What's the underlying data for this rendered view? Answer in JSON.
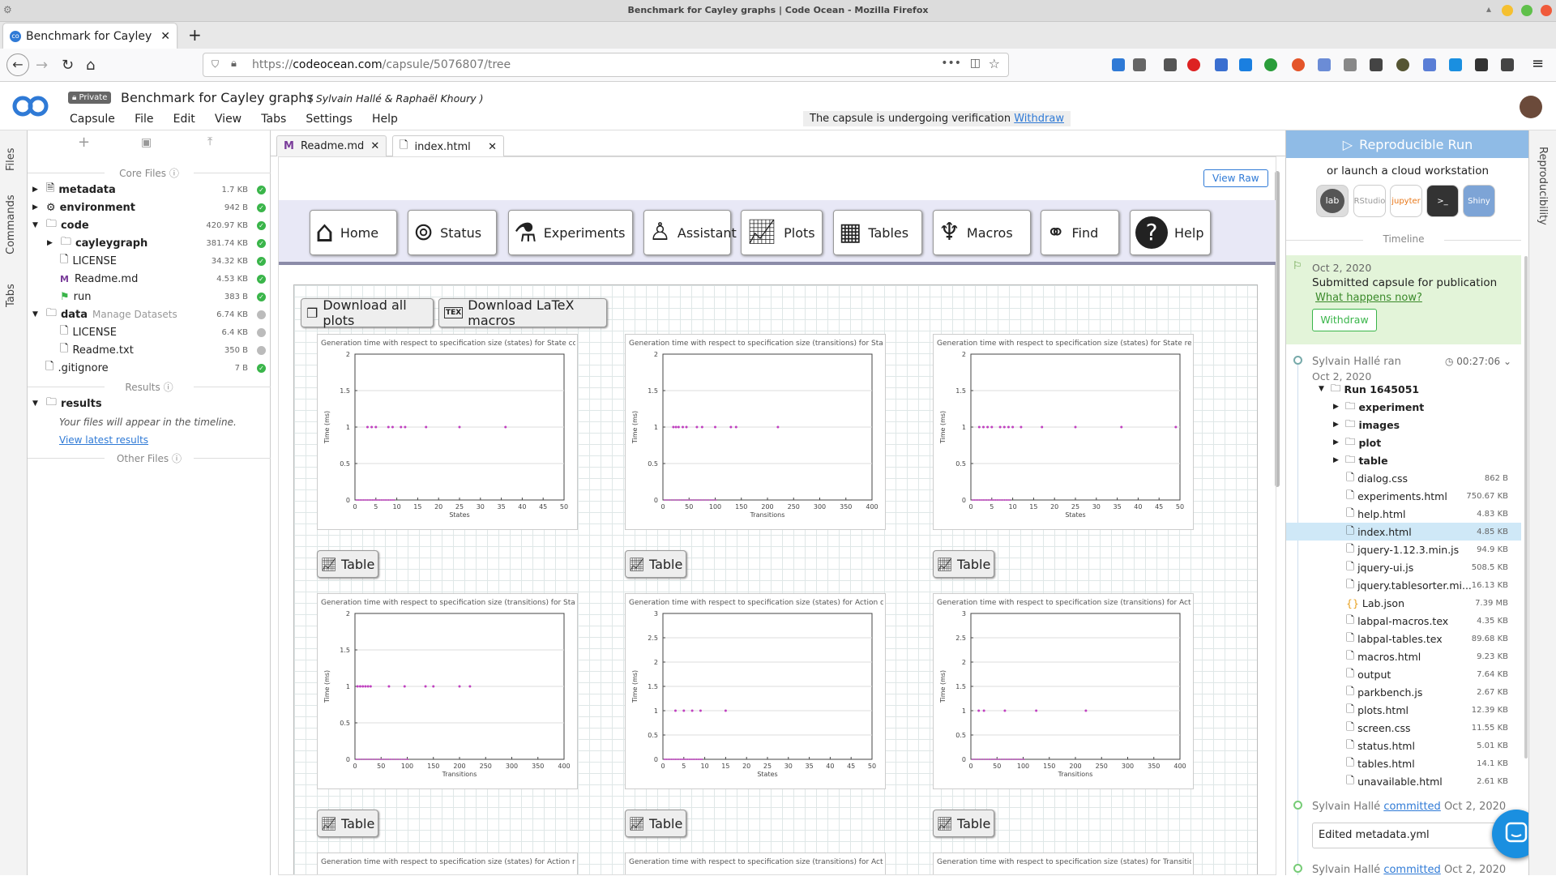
{
  "window": {
    "title": "Benchmark for Cayley graphs | Code Ocean - Mozilla Firefox"
  },
  "browser_tab": {
    "label": "Benchmark for Cayley gr"
  },
  "url": {
    "prefix": "https://",
    "host": "codeocean.com",
    "path": "/capsule/5076807/tree"
  },
  "app": {
    "private_label": "Private",
    "title": "Benchmark for Cayley graphs",
    "authors": "( Sylvain Hallé & Raphaël Khoury )",
    "verification": "The capsule is undergoing verification",
    "withdraw_link": "Withdraw",
    "menu": [
      "Capsule",
      "File",
      "Edit",
      "View",
      "Tabs",
      "Settings",
      "Help"
    ]
  },
  "left_strip": {
    "tabs": [
      "Files",
      "Commands",
      "Tabs"
    ]
  },
  "files": {
    "core_label": "Core Files",
    "results_label": "Results",
    "other_label": "Other Files",
    "rows": [
      {
        "name": "metadata",
        "size": "1.7 KB",
        "bold": true
      },
      {
        "name": "environment",
        "size": "942 B",
        "bold": true
      },
      {
        "name": "code",
        "size": "420.97 KB",
        "bold": true
      },
      {
        "name": "cayleygraph",
        "size": "381.74 KB",
        "bold": true
      },
      {
        "name": "LICENSE",
        "size": "34.32 KB"
      },
      {
        "name": "Readme.md",
        "size": "4.53 KB"
      },
      {
        "name": "run",
        "size": "383 B"
      },
      {
        "name": "data",
        "size": "6.74 KB",
        "bold": true
      },
      {
        "name": "LICENSE",
        "size": "6.4 KB"
      },
      {
        "name": "Readme.txt",
        "size": "350 B"
      },
      {
        "name": ".gitignore",
        "size": "7 B"
      }
    ],
    "manage_datasets": "Manage Datasets",
    "results_folder": "results",
    "results_note": "Your files will appear in the timeline.",
    "view_latest": "View latest results"
  },
  "editor": {
    "tabs": [
      "Readme.md",
      "index.html"
    ],
    "view_raw": "View Raw"
  },
  "page_nav": [
    "Home",
    "Status",
    "Experiments",
    "Assistant",
    "Plots",
    "Tables",
    "Macros",
    "Find",
    "Help"
  ],
  "downloads": {
    "all_plots": "Download all plots",
    "latex": "Download LaTeX macros"
  },
  "plots": [
    {
      "title": "Generation time with respect to specification size (states) for State coverage",
      "xlabel": "States",
      "ylabel": "Time (ms)",
      "xticks": [
        "0",
        "5",
        "10",
        "15",
        "20",
        "25",
        "30",
        "35",
        "40",
        "45",
        "50"
      ],
      "yticks": [
        "0",
        "0.5",
        "1",
        "1.5",
        "2"
      ],
      "ymax": 2,
      "xmax": 50,
      "points": [
        [
          3,
          1
        ],
        [
          4,
          1
        ],
        [
          5,
          1
        ],
        [
          8,
          1
        ],
        [
          9,
          1
        ],
        [
          11,
          1
        ],
        [
          12,
          1
        ],
        [
          17,
          1
        ],
        [
          25,
          1
        ],
        [
          36,
          1
        ]
      ]
    },
    {
      "title": "Generation time with respect to specification size (transitions) for State coverage",
      "xlabel": "Transitions",
      "ylabel": "Time (ms)",
      "xticks": [
        "0",
        "50",
        "100",
        "150",
        "200",
        "250",
        "300",
        "350",
        "400"
      ],
      "yticks": [
        "0",
        "0.5",
        "1",
        "1.5",
        "2"
      ],
      "ymax": 2,
      "xmax": 400,
      "points": [
        [
          20,
          1
        ],
        [
          25,
          1
        ],
        [
          30,
          1
        ],
        [
          38,
          1
        ],
        [
          45,
          1
        ],
        [
          65,
          1
        ],
        [
          75,
          1
        ],
        [
          100,
          1
        ],
        [
          130,
          1
        ],
        [
          140,
          1
        ],
        [
          220,
          1
        ]
      ]
    },
    {
      "title": "Generation time with respect to specification size (states) for State residual coverage",
      "xlabel": "States",
      "ylabel": "Time (ms)",
      "xticks": [
        "0",
        "5",
        "10",
        "15",
        "20",
        "25",
        "30",
        "35",
        "40",
        "45",
        "50"
      ],
      "yticks": [
        "0",
        "0.5",
        "1",
        "1.5",
        "2"
      ],
      "ymax": 2,
      "xmax": 50,
      "points": [
        [
          2,
          1
        ],
        [
          3,
          1
        ],
        [
          4,
          1
        ],
        [
          5,
          1
        ],
        [
          7,
          1
        ],
        [
          8,
          1
        ],
        [
          9,
          1
        ],
        [
          10,
          1
        ],
        [
          12,
          1
        ],
        [
          17,
          1
        ],
        [
          25,
          1
        ],
        [
          36,
          1
        ],
        [
          49,
          1
        ]
      ]
    },
    {
      "title": "Generation time with respect to specification size (transitions) for State residual coverage",
      "xlabel": "Transitions",
      "ylabel": "Time (ms)",
      "xticks": [
        "0",
        "50",
        "100",
        "150",
        "200",
        "250",
        "300",
        "350",
        "400"
      ],
      "yticks": [
        "0",
        "0.5",
        "1",
        "1.5",
        "2"
      ],
      "ymax": 2,
      "xmax": 400,
      "points": [
        [
          5,
          1
        ],
        [
          10,
          1
        ],
        [
          15,
          1
        ],
        [
          20,
          1
        ],
        [
          25,
          1
        ],
        [
          30,
          1
        ],
        [
          65,
          1
        ],
        [
          95,
          1
        ],
        [
          135,
          1
        ],
        [
          150,
          1
        ],
        [
          200,
          1
        ],
        [
          220,
          1
        ]
      ]
    },
    {
      "title": "Generation time with respect to specification size (states) for Action coverage",
      "xlabel": "States",
      "ylabel": "Time (ms)",
      "xticks": [
        "0",
        "5",
        "10",
        "15",
        "20",
        "25",
        "30",
        "35",
        "40",
        "45",
        "50"
      ],
      "yticks": [
        "0",
        "0.5",
        "1",
        "1.5",
        "2",
        "2.5",
        "3"
      ],
      "ymax": 3,
      "xmax": 50,
      "points": [
        [
          3,
          1
        ],
        [
          5,
          1
        ],
        [
          7,
          1
        ],
        [
          9,
          1
        ],
        [
          15,
          1
        ]
      ]
    },
    {
      "title": "Generation time with respect to specification size (transitions) for Action coverage",
      "xlabel": "Transitions",
      "ylabel": "Time (ms)",
      "xticks": [
        "0",
        "50",
        "100",
        "150",
        "200",
        "250",
        "300",
        "350",
        "400"
      ],
      "yticks": [
        "0",
        "0.5",
        "1",
        "1.5",
        "2",
        "2.5",
        "3"
      ],
      "ymax": 3,
      "xmax": 400,
      "points": [
        [
          15,
          1
        ],
        [
          25,
          1
        ],
        [
          65,
          1
        ],
        [
          125,
          1
        ],
        [
          220,
          1
        ]
      ]
    }
  ],
  "bottom_plot_titles": [
    "Generation time with respect to specification size (states) for Action residual coverage",
    "Generation time with respect to specification size (transitions) for Action residual coverage",
    "Generation time with respect to specification size (states) for Transition coverage"
  ],
  "table_label": "Table",
  "right": {
    "run_button": "Reproducible Run",
    "launch_text": "or launch a cloud workstation",
    "workstations": [
      "lab",
      "RStudio",
      "jupyter",
      ">_",
      "Shiny"
    ],
    "timeline_label": "Timeline",
    "submitted": {
      "date": "Oct 2, 2020",
      "text": "Submitted capsule for publication",
      "link": "What happens now?",
      "withdraw": "Withdraw"
    },
    "run": {
      "who": "Sylvain Hallé ran",
      "date": "Oct 2, 2020",
      "duration": "00:27:06",
      "run_name": "Run 1645051"
    },
    "run_items": [
      {
        "name": "experiment",
        "folder": true
      },
      {
        "name": "images",
        "folder": true
      },
      {
        "name": "plot",
        "folder": true
      },
      {
        "name": "table",
        "folder": true
      },
      {
        "name": "dialog.css",
        "size": "862 B"
      },
      {
        "name": "experiments.html",
        "size": "750.67 KB"
      },
      {
        "name": "help.html",
        "size": "4.83 KB"
      },
      {
        "name": "index.html",
        "size": "4.85 KB",
        "selected": true
      },
      {
        "name": "jquery-1.12.3.min.js",
        "size": "94.9 KB"
      },
      {
        "name": "jquery-ui.js",
        "size": "508.5 KB"
      },
      {
        "name": "jquery.tablesorter.mi...",
        "size": "16.13 KB"
      },
      {
        "name": "Lab.json",
        "size": "7.39 MB"
      },
      {
        "name": "labpal-macros.tex",
        "size": "4.35 KB"
      },
      {
        "name": "labpal-tables.tex",
        "size": "89.68 KB"
      },
      {
        "name": "macros.html",
        "size": "9.23 KB"
      },
      {
        "name": "output",
        "size": "7.64 KB"
      },
      {
        "name": "parkbench.js",
        "size": "2.67 KB"
      },
      {
        "name": "plots.html",
        "size": "12.39 KB"
      },
      {
        "name": "screen.css",
        "size": "11.55 KB"
      },
      {
        "name": "status.html",
        "size": "5.01 KB"
      },
      {
        "name": "tables.html",
        "size": "14.1 KB"
      },
      {
        "name": "unavailable.html",
        "size": "2.61 KB"
      }
    ],
    "commit1": {
      "who": "Sylvain Hallé",
      "link": "committed",
      "date": "Oct 2, 2020",
      "message": "Edited metadata.yml"
    },
    "commit2": {
      "who": "Sylvain Hallé",
      "link": "committed",
      "date": "Oct 2, 2020"
    },
    "side_tab": "Reproducibility"
  },
  "colors": {
    "accent": "#2f7ad6",
    "run_btn": "#8fbbe6",
    "ok": "#3ab54a",
    "point": "#c040c0"
  }
}
